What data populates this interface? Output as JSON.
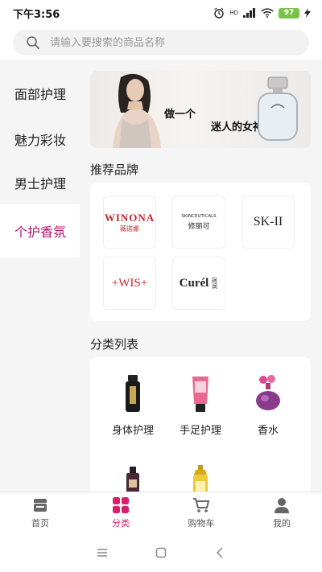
{
  "status": {
    "time": "下午3:56",
    "network": "HD",
    "battery": "97"
  },
  "search": {
    "placeholder": "请输入要搜索的商品名称"
  },
  "sidebar": {
    "items": [
      {
        "label": "面部护理",
        "active": false
      },
      {
        "label": "魅力彩妆",
        "active": false
      },
      {
        "label": "男士护理",
        "active": false
      },
      {
        "label": "个护香氛",
        "active": true
      }
    ]
  },
  "banner": {
    "line1": "做一个",
    "line2": "迷人的女神"
  },
  "brands": {
    "title": "推荐品牌",
    "items": [
      {
        "name": "WINONA",
        "subtitle": "薇诺娜",
        "color": "#c0282d"
      },
      {
        "name": "SKINCEUTICALS",
        "subtitle": "修丽可",
        "color": "#222222"
      },
      {
        "name": "SK-II",
        "subtitle": "",
        "color": "#222222"
      },
      {
        "name": "+WIS+",
        "subtitle": "",
        "color": "#c0282d"
      },
      {
        "name": "Curél",
        "subtitle": "珂润",
        "color": "#222222"
      }
    ]
  },
  "categories": {
    "title": "分类列表",
    "items": [
      {
        "label": "身体护理",
        "icon": "black-bottle-icon"
      },
      {
        "label": "手足护理",
        "icon": "pink-tube-icon"
      },
      {
        "label": "香水",
        "icon": "perfume-icon"
      }
    ]
  },
  "tabbar": {
    "items": [
      {
        "label": "首页",
        "icon": "home-icon",
        "active": false
      },
      {
        "label": "分类",
        "icon": "category-grid-icon",
        "active": true
      },
      {
        "label": "购物车",
        "icon": "cart-icon",
        "active": false
      },
      {
        "label": "我的",
        "icon": "user-icon",
        "active": false
      }
    ]
  },
  "colors": {
    "accent": "#d81e6c",
    "sidebar_active": "#b2196f",
    "battery": "#7cc14a"
  }
}
